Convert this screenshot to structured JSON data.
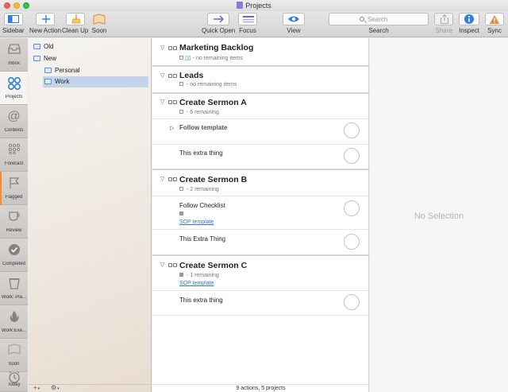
{
  "window": {
    "title": "Projects"
  },
  "toolbar": {
    "sidebar": "Sidebar",
    "new_action": "New Action",
    "clean_up": "Clean Up",
    "soon": "Soon",
    "quick_open": "Quick Open",
    "focus": "Focus",
    "view": "View",
    "search_placeholder": "Search",
    "search": "Search",
    "share": "Share",
    "inspect": "Inspect",
    "sync": "Sync"
  },
  "tabs": [
    {
      "label": "Inbox"
    },
    {
      "label": "Projects"
    },
    {
      "label": "Contexts"
    },
    {
      "label": "Forecast"
    },
    {
      "label": "Flagged"
    },
    {
      "label": "Review"
    },
    {
      "label": "Completed"
    },
    {
      "label": "Work: Pla..."
    },
    {
      "label": "Work:Exe..."
    },
    {
      "label": "Soon"
    },
    {
      "label": "Today"
    }
  ],
  "folders": [
    {
      "name": "Old"
    },
    {
      "name": "New"
    },
    {
      "name": "Personal"
    },
    {
      "name": "Work"
    }
  ],
  "folders_footer": {
    "add": "+",
    "gear": "⚙"
  },
  "projects": [
    {
      "title": "Marketing Backlog",
      "meta": "- no remaining items"
    },
    {
      "title": "Leads",
      "meta": "- no remaining items"
    },
    {
      "title": "Create Sermon A",
      "meta": "- 6 remaining",
      "actions": [
        "Follow template",
        "This extra thing"
      ]
    },
    {
      "title": "Create Sermon B",
      "meta": "- 2 remaining",
      "actions": [
        "Follow Checklist",
        "This Extra Thing"
      ],
      "link": "SOP template"
    },
    {
      "title": "Create Sermon C",
      "meta": "- 1 remaining",
      "actions": [
        "This extra thing"
      ],
      "link": "SOP template"
    }
  ],
  "status": "9 actions, 5 projects",
  "inspector": {
    "empty": "No Selection"
  },
  "colors": {
    "accent": "#2a7bd1",
    "selection": "#c4d4e8",
    "flag_bar": "#f08c3a"
  }
}
